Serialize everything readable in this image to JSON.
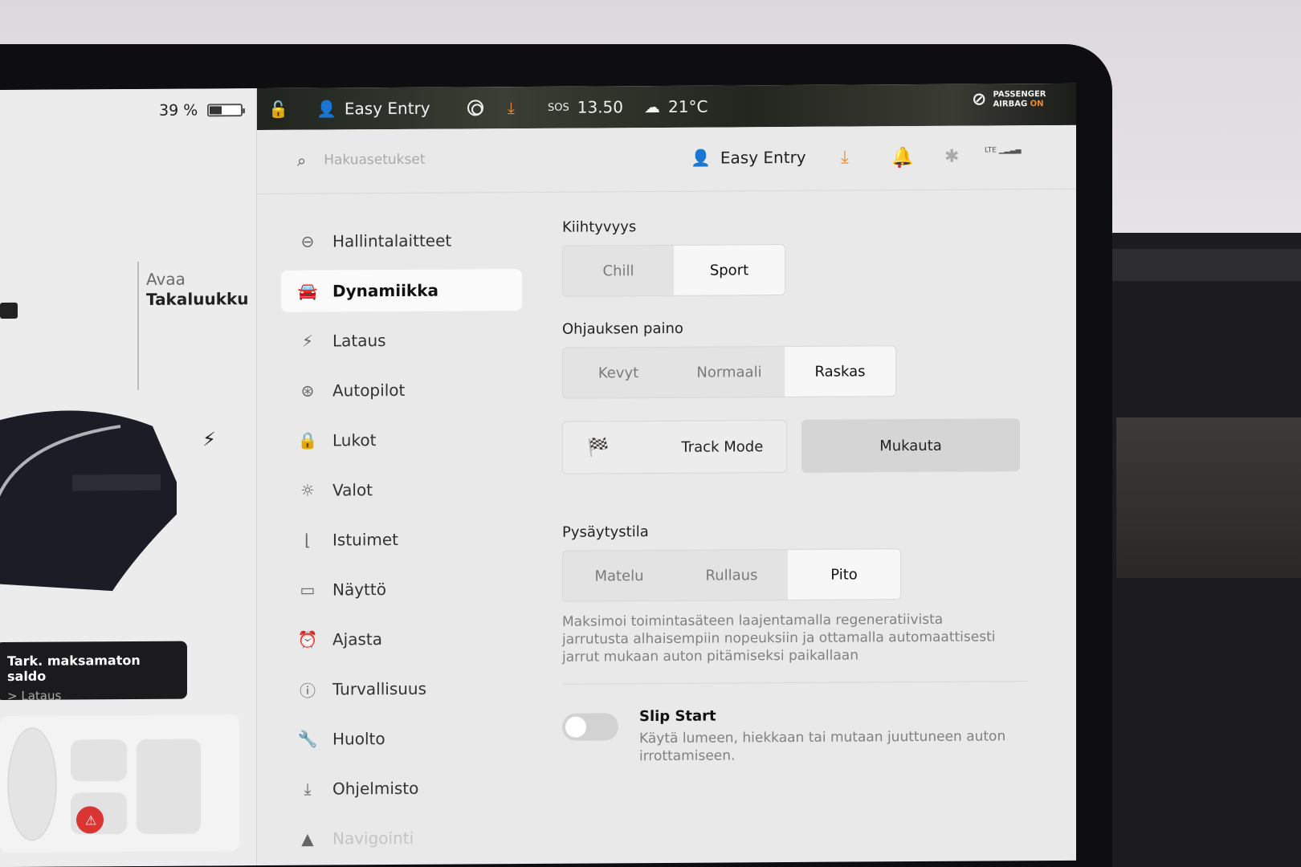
{
  "car_panel": {
    "battery_percent": "39 %",
    "battery_level": 0.39,
    "trunk_action": "Avaa",
    "trunk_label": "Takaluukku",
    "toast_title": "Tark. maksamaton saldo",
    "toast_sub": "> Lataus"
  },
  "status_bar": {
    "profile": "Easy Entry",
    "sos": "SOS",
    "time": "13.50",
    "temperature": "21°C",
    "airbag_line1": "PASSENGER",
    "airbag_line2": "AIRBAG",
    "airbag_state": "ON",
    "accent_color": "#f08a2c"
  },
  "header": {
    "search_placeholder": "Hakuasetukset",
    "profile": "Easy Entry",
    "lte": "LTE"
  },
  "menu": {
    "items": [
      {
        "label": "Hallintalaitteet",
        "icon": "toggle-icon"
      },
      {
        "label": "Dynamiikka",
        "icon": "car-icon",
        "active": true
      },
      {
        "label": "Lataus",
        "icon": "bolt-icon"
      },
      {
        "label": "Autopilot",
        "icon": "steering-wheel-icon"
      },
      {
        "label": "Lukot",
        "icon": "lock-icon"
      },
      {
        "label": "Valot",
        "icon": "sun-icon"
      },
      {
        "label": "Istuimet",
        "icon": "seat-icon"
      },
      {
        "label": "Näyttö",
        "icon": "display-icon"
      },
      {
        "label": "Ajasta",
        "icon": "alarm-clock-icon"
      },
      {
        "label": "Turvallisuus",
        "icon": "alert-circle-icon"
      },
      {
        "label": "Huolto",
        "icon": "wrench-icon"
      },
      {
        "label": "Ohjelmisto",
        "icon": "download-icon"
      },
      {
        "label": "Navigointi",
        "icon": "navigation-icon"
      }
    ]
  },
  "dynamics": {
    "acceleration_label": "Kiihtyvyys",
    "acceleration_options": [
      "Chill",
      "Sport"
    ],
    "acceleration_selected": "Sport",
    "steering_label": "Ohjauksen paino",
    "steering_options": [
      "Kevyt",
      "Normaali",
      "Raskas"
    ],
    "steering_selected": "Raskas",
    "track_mode_label": "Track Mode",
    "customize_label": "Mukauta",
    "stopping_label": "Pysäytystila",
    "stopping_options": [
      "Matelu",
      "Rullaus",
      "Pito"
    ],
    "stopping_selected": "Pito",
    "stopping_desc": "Maksimoi toimintasäteen laajentamalla regeneratiivista jarrutusta alhaisempiin nopeuksiin ja ottamalla automaattisesti jarrut mukaan auton pitämiseksi paikallaan",
    "slip_start_title": "Slip Start",
    "slip_start_desc": "Käytä lumeen, hiekkaan tai mutaan juuttuneen auton irrottamiseen.",
    "slip_start_enabled": false
  }
}
